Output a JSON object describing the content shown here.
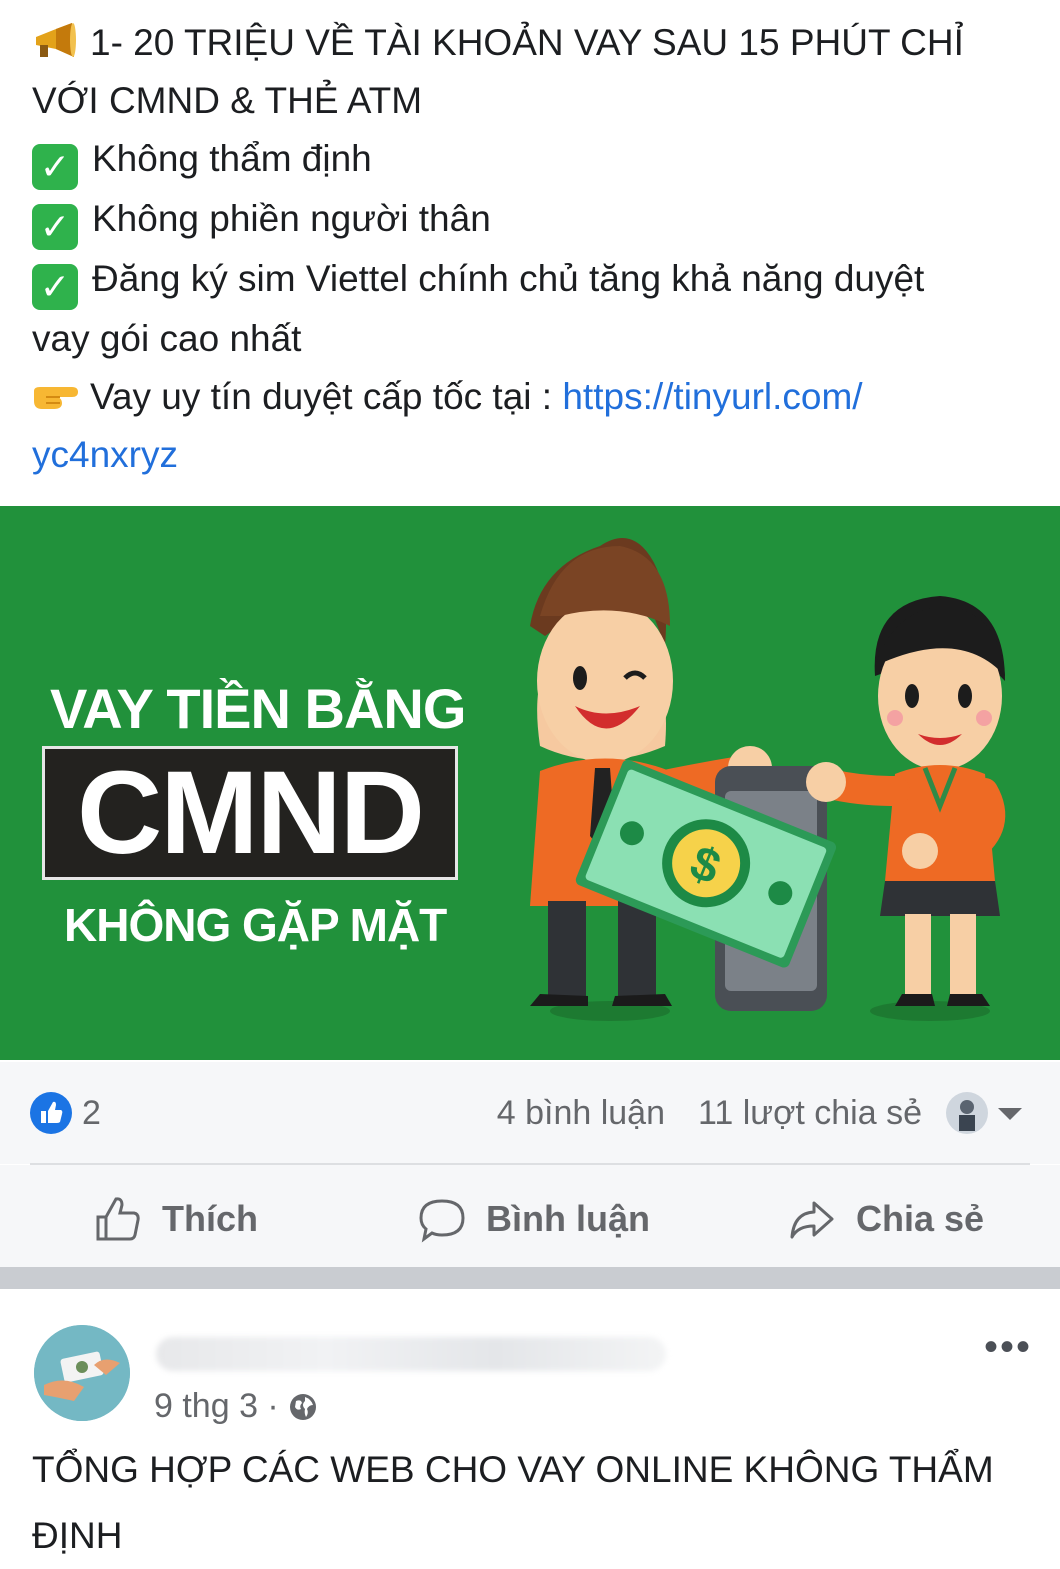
{
  "post": {
    "line1": "1- 20 TRIỆU VỀ TÀI KHOẢN VAY SAU 15 PHÚT CHỈ",
    "line2": "VỚI CMND & THẺ ATM",
    "check1": "Không thẩm định",
    "check2": "Không phiền người thân",
    "check3a": "Đăng ký sim Viettel chính chủ tăng khả năng duyệt",
    "check3b": "vay gói cao nhất",
    "cta": "Vay uy tín duyệt cấp tốc tại : ",
    "link_part1": "https://tinyurl.com/",
    "link_part2": "yc4nxryz"
  },
  "banner": {
    "line1": "VAY TIỀN BẰNG",
    "big": "CMND",
    "line2": "KHÔNG GẶP MẶT",
    "bg_color": "#21913b",
    "money_symbol": "$"
  },
  "stats": {
    "likes": "2",
    "comments": "4 bình luận",
    "shares": "11 lượt chia sẻ"
  },
  "actions": {
    "like": "Thích",
    "comment": "Bình luận",
    "share": "Chia sẻ"
  },
  "post2": {
    "time": "9 thg 3 ·",
    "text": "TỔNG HỢP CÁC WEB CHO VAY ONLINE KHÔNG THẨM ĐỊNH",
    "more": "•••"
  },
  "icons": {
    "megaphone": "megaphone-icon",
    "check": "check-mark-button-icon",
    "pointing": "pointing-right-icon",
    "like": "thumbs-up-icon",
    "comment": "speech-bubble-icon",
    "share": "share-arrow-icon",
    "globe": "globe-icon"
  }
}
